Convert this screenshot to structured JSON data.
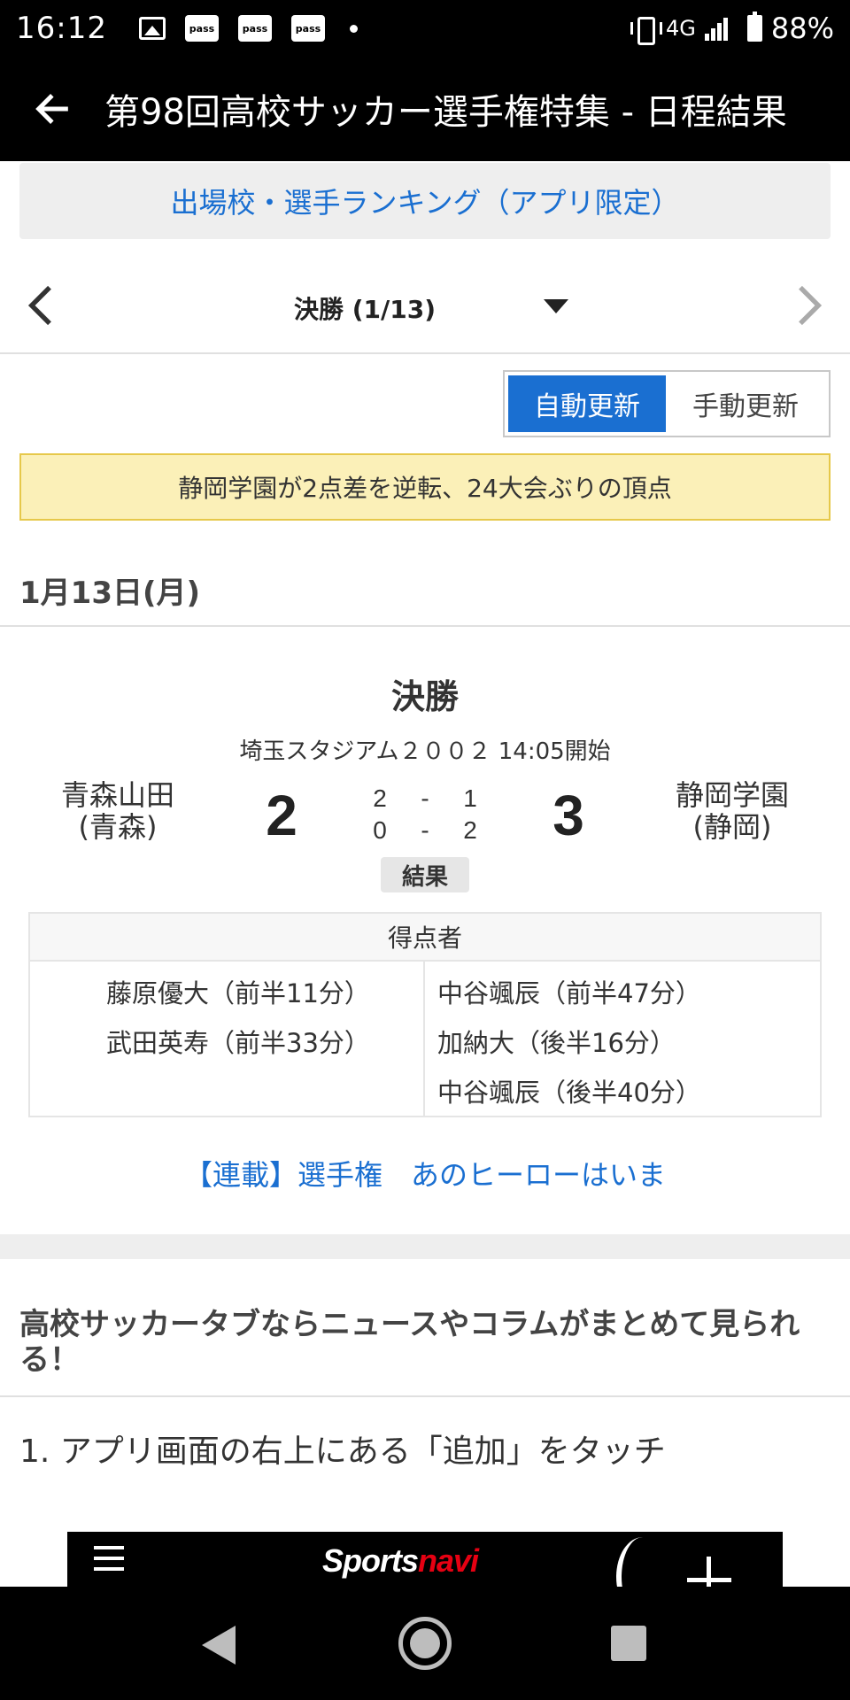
{
  "status_bar": {
    "time": "16:12",
    "notification_icons": [
      "gallery-icon",
      "pass-icon",
      "pass-icon",
      "pass-icon",
      "dot-icon"
    ],
    "pass_label": "pass",
    "network": "4G",
    "battery": "88%"
  },
  "app_bar": {
    "title": "第98回高校サッカー選手権特集 - 日程結果"
  },
  "ranking_banner": {
    "label": "出場校・選手ランキング（アプリ限定）"
  },
  "round_nav": {
    "label": "決勝 (1/13)"
  },
  "update_toggle": {
    "auto_label": "自動更新",
    "manual_label": "手動更新",
    "selected": "自動更新",
    "accent_color": "#1a6fd1"
  },
  "headline": {
    "text": "静岡学園が2点差を逆転、24大会ぶりの頂点"
  },
  "match": {
    "date": "1月13日(月)",
    "round": "決勝",
    "venue": "埼玉スタジアム２００２ 14:05開始",
    "home": {
      "name": "青森山田",
      "pref": "(青森)",
      "score": "2"
    },
    "away": {
      "name": "静岡学園",
      "pref": "(静岡)",
      "score": "3"
    },
    "halves": [
      {
        "home": "2",
        "sep": "-",
        "away": "1"
      },
      {
        "home": "0",
        "sep": "-",
        "away": "2"
      }
    ],
    "status": "結果"
  },
  "scorers": {
    "header": "得点者",
    "home": [
      "藤原優大（前半11分）",
      "武田英寿（前半33分）"
    ],
    "away": [
      "中谷颯辰（前半47分）",
      "加納大（後半16分）",
      "中谷颯辰（後半40分）"
    ]
  },
  "series_link": {
    "label": "【連載】選手権　あのヒーローはいま"
  },
  "promo": {
    "title": "高校サッカータブならニュースやコラムがまとめて見られる！",
    "step": "1.  アプリ画面の右上にある「追加」をタッチ"
  },
  "footer": {
    "logo_part1": "Sports",
    "logo_part2": "navi"
  }
}
